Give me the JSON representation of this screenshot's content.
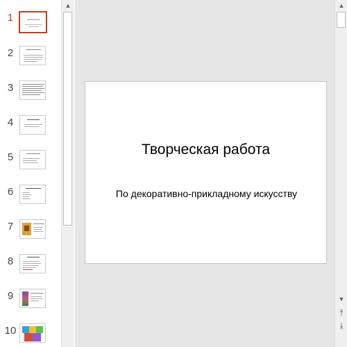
{
  "slide": {
    "title": "Творческая работа",
    "subtitle": "По декоративно-прикладному искусству"
  },
  "thumbnails": [
    {
      "number": "1",
      "active": true
    },
    {
      "number": "2",
      "active": false
    },
    {
      "number": "3",
      "active": false
    },
    {
      "number": "4",
      "active": false
    },
    {
      "number": "5",
      "active": false
    },
    {
      "number": "6",
      "active": false
    },
    {
      "number": "7",
      "active": false
    },
    {
      "number": "8",
      "active": false
    },
    {
      "number": "9",
      "active": false
    },
    {
      "number": "10",
      "active": false
    }
  ],
  "scroll": {
    "up_arrow": "▲",
    "down_arrow": "▼",
    "prev_slide": "⤒",
    "next_slide": "⤓"
  },
  "colors": {
    "active_accent": "#c43e1c",
    "pane_background": "#e6e6e6"
  }
}
